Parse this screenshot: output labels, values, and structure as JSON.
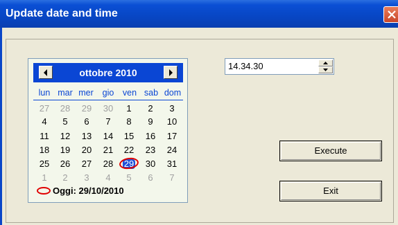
{
  "window": {
    "title": "Update date and time"
  },
  "calendar": {
    "month_title": "ottobre 2010",
    "weekdays": [
      "lun",
      "mar",
      "mer",
      "gio",
      "ven",
      "sab",
      "dom"
    ],
    "weeks": [
      [
        "27",
        "28",
        "29",
        "30",
        "1",
        "2",
        "3"
      ],
      [
        "4",
        "5",
        "6",
        "7",
        "8",
        "9",
        "10"
      ],
      [
        "11",
        "12",
        "13",
        "14",
        "15",
        "16",
        "17"
      ],
      [
        "18",
        "19",
        "20",
        "21",
        "22",
        "23",
        "24"
      ],
      [
        "25",
        "26",
        "27",
        "28",
        "29",
        "30",
        "31"
      ],
      [
        "1",
        "2",
        "3",
        "4",
        "5",
        "6",
        "7"
      ]
    ],
    "selected_day": "29",
    "today_label": "Oggi: 29/10/2010"
  },
  "time": {
    "value": "14.34.30"
  },
  "buttons": {
    "execute": "Execute",
    "exit": "Exit"
  },
  "colors": {
    "titlebar": "#0a46d4",
    "calendar_header": "#0a46d4",
    "today_marker": "#e00000"
  }
}
